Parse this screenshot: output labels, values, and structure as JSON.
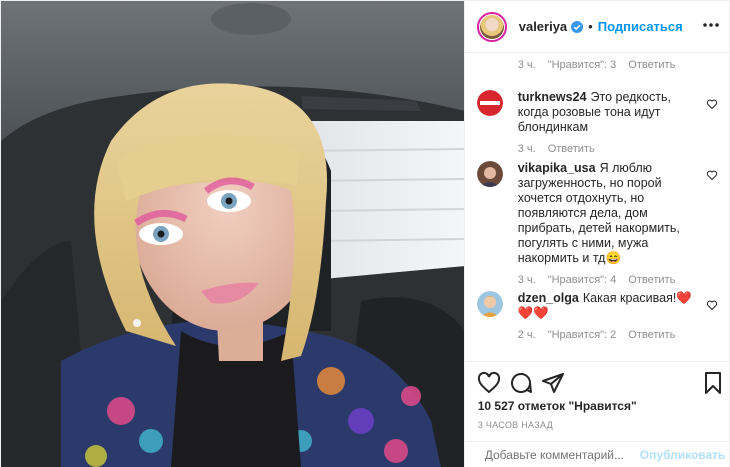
{
  "header": {
    "username": "valeriya",
    "separator": "•",
    "follow_label": "Подписаться"
  },
  "comments": [
    {
      "user": "",
      "text": "",
      "meta": {
        "time": "3 ч.",
        "likes": "\"Нравится\": 3",
        "reply": "Ответить"
      }
    },
    {
      "user": "turknews24",
      "text": "Это редкость, когда розовые тона идут блондинкам",
      "meta": {
        "time": "3 ч.",
        "reply": "Ответить"
      },
      "avatar_text": "TURKNEWS24"
    },
    {
      "user": "vikapika_usa",
      "text": "Я люблю загруженность, но порой хочется отдохнуть, но появляются дела, дом прибрать, детей накормить, погулять с ними, мужа накормить и тд😄",
      "meta": {
        "time": "3 ч.",
        "likes": "\"Нравится\": 4",
        "reply": "Ответить"
      }
    },
    {
      "user": "dzen_olga",
      "text": "Какая красивая!❤️❤️❤️",
      "meta": {
        "time": "2 ч.",
        "likes": "\"Нравится\": 2",
        "reply": "Ответить"
      }
    }
  ],
  "stats": {
    "likes": "10 527 отметок \"Нравится\"",
    "time_ago": "3 ЧАСОВ НАЗАД"
  },
  "composer": {
    "placeholder": "Добавьте комментарий...",
    "publish_label": "Опубликовать"
  },
  "icons": {
    "like": "heart-icon",
    "comment": "comment-icon",
    "share": "share-icon",
    "save": "bookmark-icon",
    "more": "more-icon",
    "emoji": "emoji-icon"
  },
  "colors": {
    "accent": "#0095f6",
    "muted": "#8e8e8e",
    "text": "#262626"
  }
}
